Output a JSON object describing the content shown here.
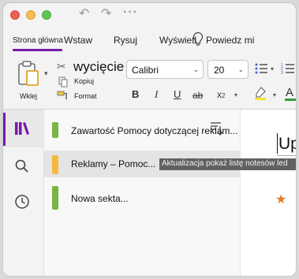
{
  "ribbon_tabs": [
    {
      "label": "Strona główna",
      "active": true
    },
    {
      "label": "Wstaw"
    },
    {
      "label": "Rysuj"
    },
    {
      "label": "Wyświetl"
    },
    {
      "label": "Powiedz mi"
    }
  ],
  "clipboard": {
    "paste_label": "Wklej",
    "cut_label": "wycięcie",
    "copy_label": "Kopiuj",
    "format_label": "Format"
  },
  "font": {
    "name": "Calibri",
    "size": "20"
  },
  "formatting": {
    "bold": "B",
    "italic": "I",
    "underline": "U",
    "strikethrough": "ab",
    "subscript": "x"
  },
  "sections": [
    {
      "label": "Zawartość Pomocy dotyczącej reklam...",
      "color": "#7cb342"
    },
    {
      "label": "Reklamy – Pomoc...",
      "color": "#f5b841"
    },
    {
      "label": "Nowa sekta...",
      "color": "#7cb342"
    }
  ],
  "tooltip": "Aktualizacja pokaż listę notesów led",
  "page": {
    "title": "Up"
  },
  "colors": {
    "accent": "#7719aa",
    "highlight": "#f5e22a",
    "font_color": "#2e9e3e"
  }
}
